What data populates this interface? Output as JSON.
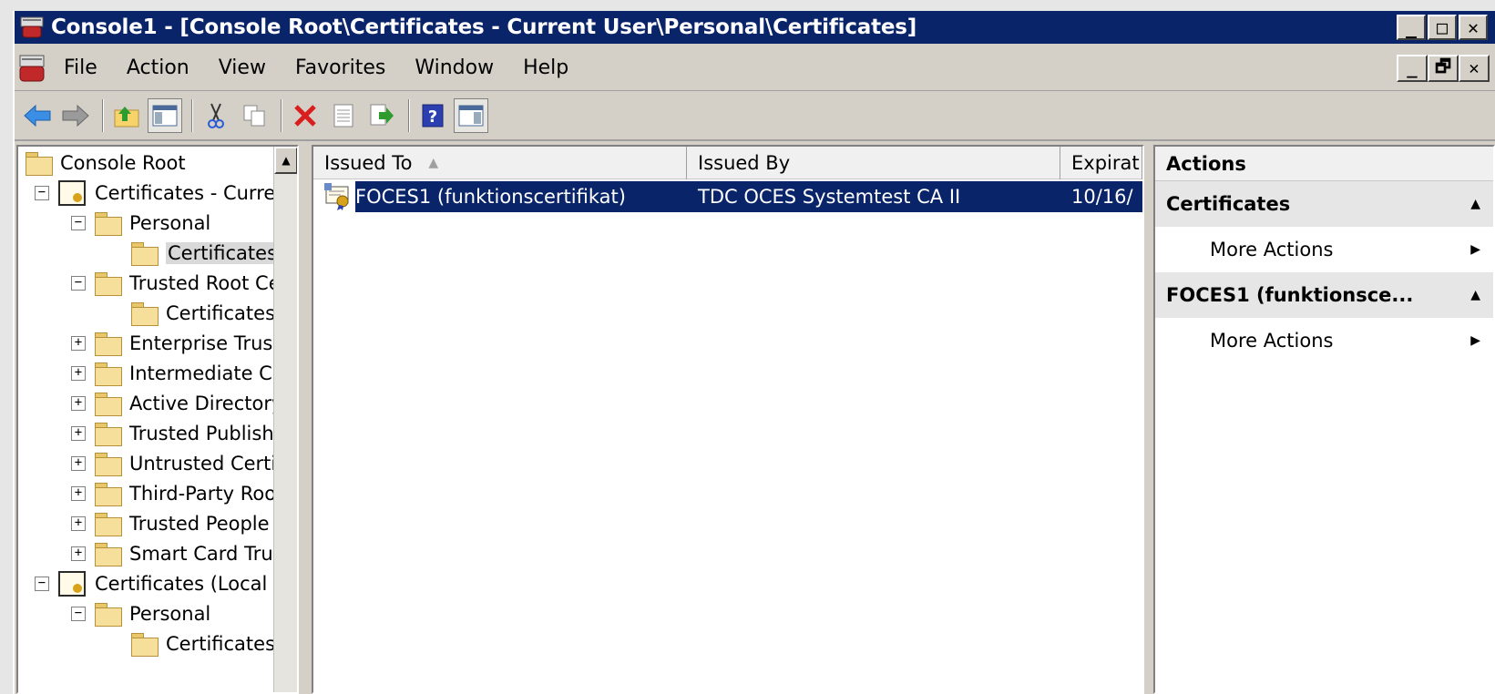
{
  "window": {
    "title": "Console1 - [Console Root\\Certificates - Current User\\Personal\\Certificates]",
    "buttons": [
      "_",
      "□",
      "✕"
    ]
  },
  "menu": {
    "items": [
      "File",
      "Action",
      "View",
      "Favorites",
      "Window",
      "Help"
    ],
    "mdi_buttons": [
      "_",
      "🗗",
      "✕"
    ]
  },
  "toolbar": {
    "icons": [
      "back-arrow-icon",
      "forward-arrow-icon",
      "up-folder-icon",
      "show-hide-tree-icon",
      "cut-icon",
      "copy-icon",
      "delete-icon",
      "properties-icon",
      "export-icon",
      "help-icon",
      "show-hide-action-pane-icon"
    ]
  },
  "tree": {
    "items": [
      {
        "label": "Console Root",
        "level": 0,
        "expander": "",
        "icon": "folder"
      },
      {
        "label": "Certificates - Current",
        "level": 1,
        "expander": "⊟",
        "icon": "cert-store"
      },
      {
        "label": "Personal",
        "level": 2,
        "expander": "⊟",
        "icon": "folder"
      },
      {
        "label": "Certificates",
        "level": 3,
        "expander": "",
        "icon": "folder",
        "selected": true
      },
      {
        "label": "Trusted Root Ce",
        "level": 2,
        "expander": "⊟",
        "icon": "folder"
      },
      {
        "label": "Certificates",
        "level": 3,
        "expander": "",
        "icon": "folder"
      },
      {
        "label": "Enterprise Trust",
        "level": 2,
        "expander": "⊞",
        "icon": "folder"
      },
      {
        "label": "Intermediate Ce",
        "level": 2,
        "expander": "⊞",
        "icon": "folder"
      },
      {
        "label": "Active Directory",
        "level": 2,
        "expander": "⊞",
        "icon": "folder"
      },
      {
        "label": "Trusted Publishe",
        "level": 2,
        "expander": "⊞",
        "icon": "folder"
      },
      {
        "label": "Untrusted Certi",
        "level": 2,
        "expander": "⊞",
        "icon": "folder"
      },
      {
        "label": "Third-Party Roo",
        "level": 2,
        "expander": "⊞",
        "icon": "folder"
      },
      {
        "label": "Trusted People",
        "level": 2,
        "expander": "⊞",
        "icon": "folder"
      },
      {
        "label": "Smart Card Trus",
        "level": 2,
        "expander": "⊞",
        "icon": "folder"
      },
      {
        "label": "Certificates (Local C",
        "level": 1,
        "expander": "⊟",
        "icon": "cert-store"
      },
      {
        "label": "Personal",
        "level": 2,
        "expander": "⊟",
        "icon": "folder"
      },
      {
        "label": "Certificates",
        "level": 3,
        "expander": "",
        "icon": "folder"
      }
    ]
  },
  "list": {
    "columns": [
      "Issued To",
      "Issued By",
      "Expirat"
    ],
    "sort_indicator": "▲",
    "rows": [
      {
        "issued_to": "FOCES1 (funktionscertifikat)",
        "issued_by": "TDC OCES Systemtest CA II",
        "expiration": "10/16/"
      }
    ]
  },
  "actions": {
    "header": "Actions",
    "sections": [
      {
        "title": "Certificates",
        "items": [
          "More Actions"
        ]
      },
      {
        "title": "FOCES1 (funktionsce...",
        "items": [
          "More Actions"
        ]
      }
    ],
    "collapse_glyph": "▲",
    "more_glyph": "▶"
  },
  "colors": {
    "titlebar": "#0a246a",
    "selection": "#0a246a",
    "chrome": "#d4d0c8"
  }
}
